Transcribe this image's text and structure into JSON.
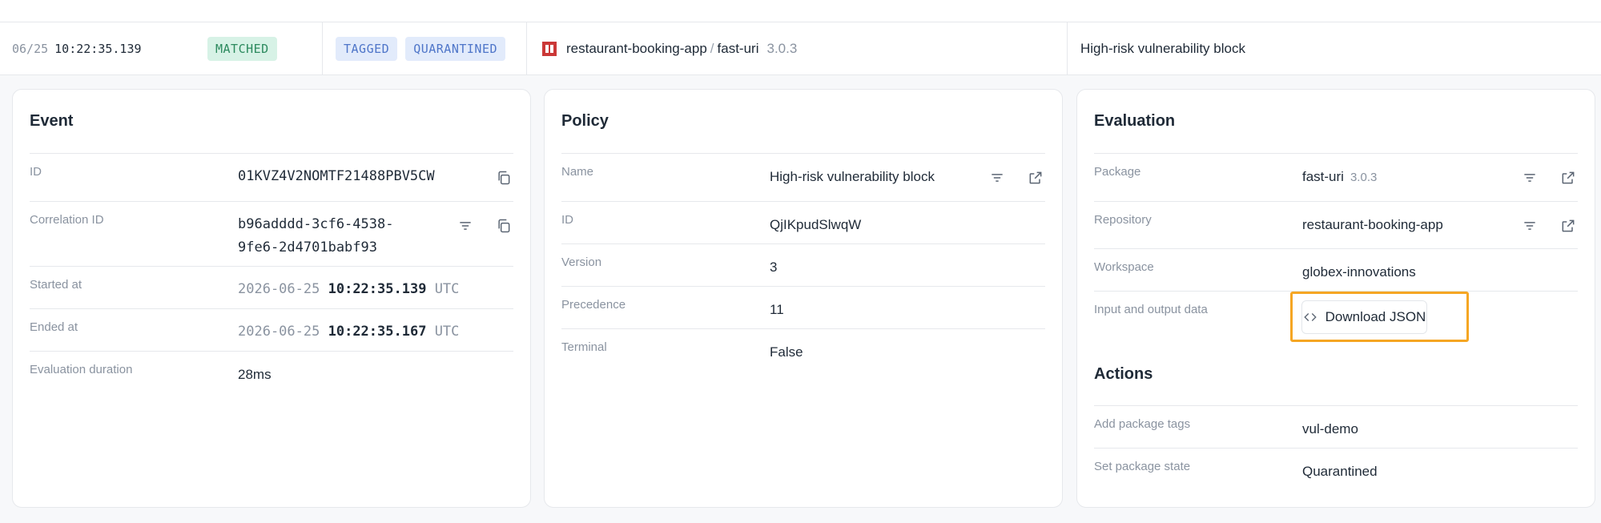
{
  "event_row": {
    "date": "06/25",
    "time": "10:22:35.139",
    "status_badge": "MATCHED",
    "tags": [
      "TAGGED",
      "QUARANTINED"
    ],
    "repo": "restaurant-booking-app",
    "separator": "/",
    "package": "fast-uri",
    "version": "3.0.3",
    "policy_name": "High-risk vulnerability block"
  },
  "event_card": {
    "title": "Event",
    "rows": [
      {
        "label": "ID",
        "value": "01KVZ4V2NOMTF21488PBV5CW"
      },
      {
        "label": "Correlation ID",
        "value_line1": "b96adddd-3cf6-4538-",
        "value_line2": "9fe6-2d4701babf93"
      },
      {
        "label": "Started at",
        "date": "2026-06-25",
        "time": "10:22:35.139",
        "tz": "UTC"
      },
      {
        "label": "Ended at",
        "date": "2026-06-25",
        "time": "10:22:35.167",
        "tz": "UTC"
      },
      {
        "label": "Evaluation duration",
        "value": "28ms"
      }
    ]
  },
  "policy_card": {
    "title": "Policy",
    "rows": [
      {
        "label": "Name",
        "value": "High-risk vulnerability block"
      },
      {
        "label": "ID",
        "value": "QjIKpudSlwqW"
      },
      {
        "label": "Version",
        "value": "3"
      },
      {
        "label": "Precedence",
        "value": "11"
      },
      {
        "label": "Terminal",
        "value": "False"
      }
    ]
  },
  "evaluation_card": {
    "title": "Evaluation",
    "rows": [
      {
        "label": "Package",
        "value": "fast-uri",
        "version": "3.0.3"
      },
      {
        "label": "Repository",
        "value": "restaurant-booking-app"
      },
      {
        "label": "Workspace",
        "value": "globex-innovations"
      },
      {
        "label": "Input and output data",
        "button": "Download JSON"
      }
    ],
    "actions_title": "Actions",
    "actions": [
      {
        "label": "Add package tags",
        "value": "vul-demo"
      },
      {
        "label": "Set package state",
        "value": "Quarantined"
      }
    ]
  },
  "colors": {
    "matched_bg": "#d7f2e6",
    "matched_text": "#2c8a5e",
    "tag_bg": "#e2ebfb",
    "tag_text": "#4f76c9",
    "highlight": "#f5a623",
    "npm_red": "#cb3837"
  },
  "icons": [
    "copy-icon",
    "filter-icon",
    "external-link-icon",
    "code-icon",
    "npm-icon"
  ]
}
